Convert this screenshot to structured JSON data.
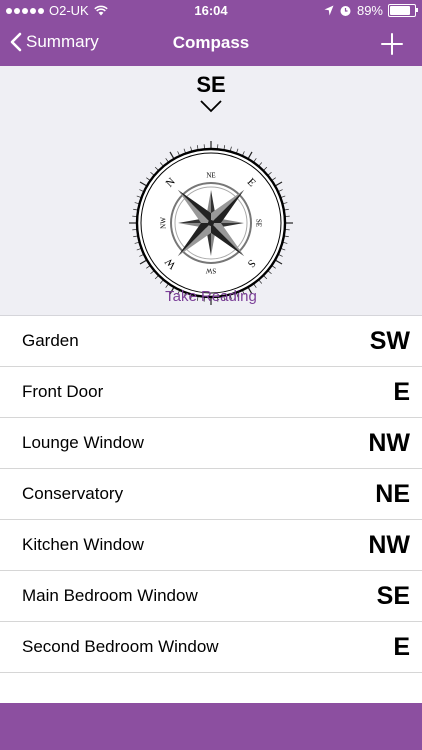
{
  "status": {
    "carrier": "O2-UK",
    "time": "16:04",
    "battery": "89%",
    "battery_level": 0.89
  },
  "nav": {
    "back_label": "Summary",
    "title": "Compass",
    "add_icon": "plus-icon"
  },
  "compass": {
    "heading": "SE",
    "take_reading": "Take Reading",
    "dial_letters": [
      "N",
      "NE",
      "E",
      "SE",
      "S",
      "SW",
      "W",
      "NW"
    ]
  },
  "readings": [
    {
      "label": "Garden",
      "direction": "SW"
    },
    {
      "label": "Front Door",
      "direction": "E"
    },
    {
      "label": "Lounge Window",
      "direction": "NW"
    },
    {
      "label": "Conservatory",
      "direction": "NE"
    },
    {
      "label": "Kitchen Window",
      "direction": "NW"
    },
    {
      "label": "Main Bedroom Window",
      "direction": "SE"
    },
    {
      "label": "Second Bedroom Window",
      "direction": "E"
    }
  ],
  "colors": {
    "accent": "#8c4fa0",
    "link": "#7b3f98",
    "panel": "#efeff4"
  }
}
